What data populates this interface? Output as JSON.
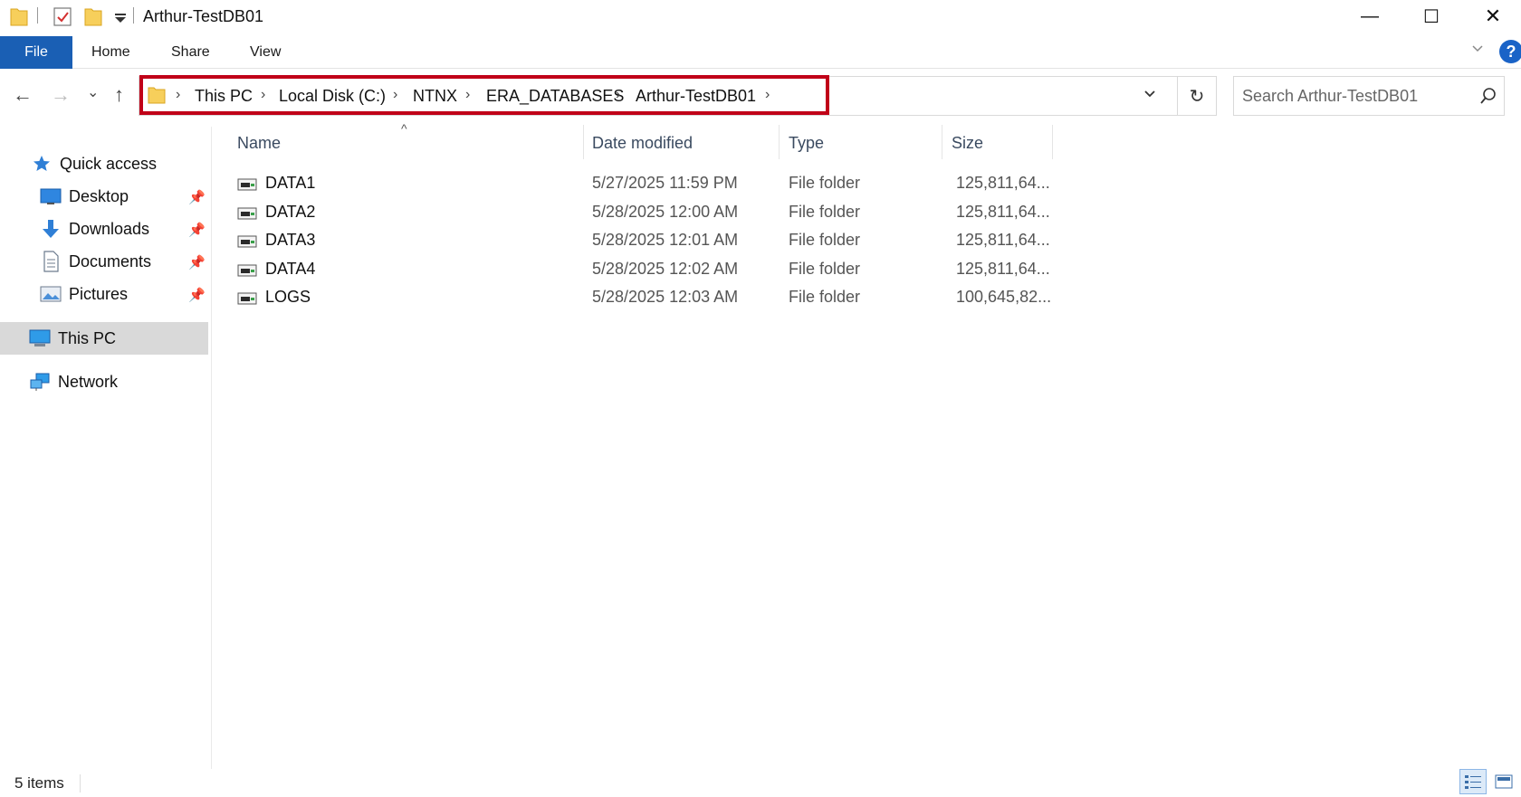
{
  "window": {
    "title": "Arthur-TestDB01",
    "minimize_glyph": "—",
    "maximize_glyph": "☐",
    "close_glyph": "✕"
  },
  "ribbon": {
    "file": "File",
    "tabs": [
      "Home",
      "Share",
      "View"
    ],
    "help_glyph": "?"
  },
  "nav": {
    "back_glyph": "←",
    "forward_glyph": "→",
    "recent_glyph": "⌄",
    "up_glyph": "↑"
  },
  "address": {
    "crumbs": [
      "This PC",
      "Local Disk (C:)",
      "NTNX",
      "ERA_DATABASES",
      "Arthur-TestDB01"
    ],
    "separator": "›",
    "dropdown_glyph": "⌄",
    "refresh_glyph": "↻"
  },
  "search": {
    "placeholder": "Search Arthur-TestDB01"
  },
  "sidebar": {
    "quick_access": "Quick access",
    "items": [
      {
        "label": "Desktop",
        "icon": "desktop-icon"
      },
      {
        "label": "Downloads",
        "icon": "download-arrow-icon"
      },
      {
        "label": "Documents",
        "icon": "document-icon"
      },
      {
        "label": "Pictures",
        "icon": "pictures-icon"
      }
    ],
    "this_pc": "This PC",
    "network": "Network",
    "pin_glyph": "📌"
  },
  "columns": {
    "name": "Name",
    "date": "Date modified",
    "type": "Type",
    "size": "Size",
    "sort_glyph": "^"
  },
  "files": [
    {
      "name": "DATA1",
      "date": "5/27/2025 11:59 PM",
      "type": "File folder",
      "size": "125,811,64..."
    },
    {
      "name": "DATA2",
      "date": "5/28/2025 12:00 AM",
      "type": "File folder",
      "size": "125,811,64..."
    },
    {
      "name": "DATA3",
      "date": "5/28/2025 12:01 AM",
      "type": "File folder",
      "size": "125,811,64..."
    },
    {
      "name": "DATA4",
      "date": "5/28/2025 12:02 AM",
      "type": "File folder",
      "size": "125,811,64..."
    },
    {
      "name": "LOGS",
      "date": "5/28/2025 12:03 AM",
      "type": "File folder",
      "size": "100,645,82..."
    }
  ],
  "status": {
    "count": "5 items"
  },
  "colors": {
    "accent": "#1a5fb4",
    "highlight": "#c00018",
    "selected": "#d9d9d9"
  }
}
